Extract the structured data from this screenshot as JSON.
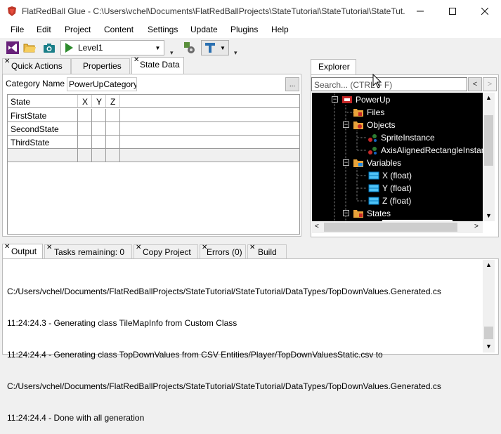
{
  "window": {
    "title": "FlatRedBall Glue - C:\\Users\\vchel\\Documents\\FlatRedBallProjects\\StateTutorial\\StateTutorial\\StateTut..."
  },
  "menu": {
    "items": [
      "File",
      "Edit",
      "Project",
      "Content",
      "Settings",
      "Update",
      "Plugins",
      "Help"
    ]
  },
  "toolbar": {
    "screen_combo_value": "Level1"
  },
  "left_tabs": [
    {
      "label": "Quick Actions"
    },
    {
      "label": "Properties"
    },
    {
      "label": "State Data"
    }
  ],
  "state_data": {
    "category_label": "Category Name",
    "category_value": "PowerUpCategory",
    "browse_label": "...",
    "columns": [
      "State",
      "X",
      "Y",
      "Z"
    ],
    "rows": [
      "FirstState",
      "SecondState",
      "ThirdState",
      ""
    ]
  },
  "explorer": {
    "tab_label": "Explorer",
    "search_placeholder": "Search... (CTRL + F)",
    "back_label": "<",
    "forward_label": ">",
    "tree": [
      {
        "label": "PowerUp"
      },
      {
        "label": "Files"
      },
      {
        "label": "Objects"
      },
      {
        "label": "SpriteInstance"
      },
      {
        "label": "AxisAlignedRectangleInstan"
      },
      {
        "label": "Variables"
      },
      {
        "label": "X (float)"
      },
      {
        "label": "Y (float)"
      },
      {
        "label": "Z (float)"
      },
      {
        "label": "States"
      }
    ]
  },
  "bottom_tabs": [
    {
      "label": "Output"
    },
    {
      "label": "Tasks remaining: 0"
    },
    {
      "label": "Copy Project"
    },
    {
      "label": "Errors (0)"
    },
    {
      "label": "Build"
    }
  ],
  "output": {
    "lines": [
      "C:/Users/vchel/Documents/FlatRedBallProjects/StateTutorial/StateTutorial/DataTypes/TopDownValues.Generated.cs",
      "11:24:24.3 - Generating class TileMapInfo from Custom Class",
      "11:24:24.4 - Generating class TopDownValues from CSV Entities/Player/TopDownValuesStatic.csv to",
      "C:/Users/vchel/Documents/FlatRedBallProjects/StateTutorial/StateTutorial/DataTypes/TopDownValues.Generated.cs",
      "11:24:24.4 - Done with all generation"
    ]
  },
  "colors": {
    "tree_background": "#000000",
    "window_background": "#f0f0f0"
  }
}
